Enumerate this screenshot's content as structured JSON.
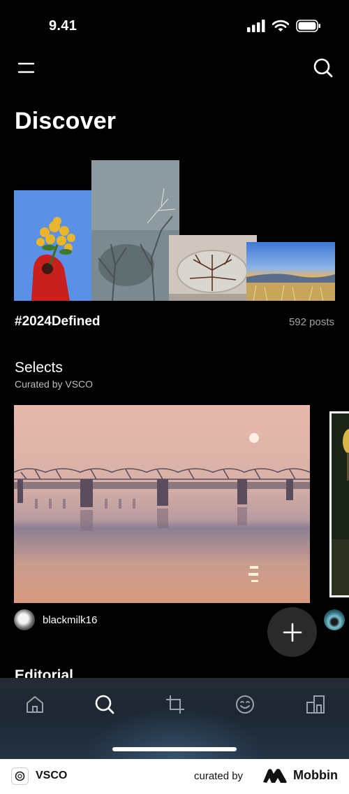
{
  "status_bar": {
    "time": "9.41"
  },
  "header": {
    "title": "Discover"
  },
  "featured_tag": {
    "tag": "#2024Defined",
    "post_count": "592 posts"
  },
  "selects": {
    "title": "Selects",
    "subtitle": "Curated by VSCO",
    "author": "blackmilk16"
  },
  "next_section": {
    "title": "Editorial"
  },
  "tab_bar": {
    "items": [
      "home",
      "discover",
      "studio",
      "spaces",
      "profile"
    ],
    "active": "discover"
  },
  "footer": {
    "app_name": "VSCO",
    "curated_by": "curated by",
    "brand": "Mobbin"
  },
  "colors": {
    "background": "#000000",
    "muted_text": "#a3a3a3",
    "fab": "#2a2a2a",
    "tab_bar": "#1f2830"
  }
}
